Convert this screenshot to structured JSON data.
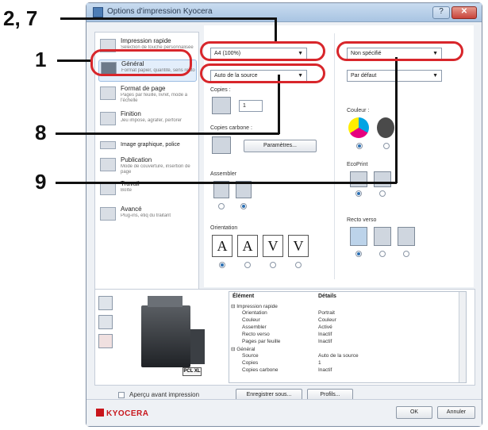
{
  "window": {
    "title": "Options d'impression Kyocera"
  },
  "callouts": [
    "2, 7",
    "1",
    "8",
    "9"
  ],
  "sidebar": {
    "items": [
      {
        "name": "Impression rapide",
        "desc": "Sélection de touche personnalisée"
      },
      {
        "name": "Général",
        "desc": "Format papier, quantité, sens recto"
      },
      {
        "name": "Format de page",
        "desc": "Pages par feuille, livret, mode à l'échelle"
      },
      {
        "name": "Finition",
        "desc": "Jeu impose, agrafer, perforer"
      },
      {
        "name": "Image graphique, police",
        "desc": ""
      },
      {
        "name": "Publication",
        "desc": "Mode de couverture, insertion de page"
      },
      {
        "name": "Travail",
        "desc": "Boîte"
      },
      {
        "name": "Avancé",
        "desc": "Plug-ins, étiq du traitant"
      }
    ]
  },
  "general": {
    "paper_size": "A4 (100%)",
    "source": "Auto de la source",
    "media_type_value": "Non spécifié",
    "default_value": "Par défaut",
    "copies_label": "Copies :",
    "copies_value": "1",
    "carbon_label": "Copies carbone :",
    "carbon_button": "Paramètres...",
    "collate_label": "Assembler",
    "orientation_label": "Orientation",
    "color_label": "Couleur :",
    "ecoprint_label": "EcoPrint",
    "duplex_label": "Recto verso"
  },
  "details": {
    "headers": [
      "Élément",
      "Détails"
    ],
    "rows": [
      [
        "⊟ Impression rapide",
        ""
      ],
      [
        "Orientation",
        "Portrait"
      ],
      [
        "Couleur",
        "Couleur"
      ],
      [
        "Assembler",
        "Activé"
      ],
      [
        "Recto verso",
        "Inactif"
      ],
      [
        "Pages par feuille",
        "Inactif"
      ],
      [
        "⊟ Général",
        ""
      ],
      [
        "Source",
        "Auto de la source"
      ],
      [
        "Copies",
        "1"
      ],
      [
        "Copies carbone",
        "Inactif"
      ]
    ]
  },
  "preview": {
    "pcl_badge": "PCL XL"
  },
  "buttons": {
    "preview_checkbox_label": "Aperçu avant impression",
    "save_as": "Enregistrer sous...",
    "profiles": "Profils...",
    "ok": "OK",
    "cancel": "Annuler"
  },
  "logo_text": "KYOCERA",
  "colors": {
    "callout_ring": "#d8262b",
    "brand": "#c8151b"
  }
}
